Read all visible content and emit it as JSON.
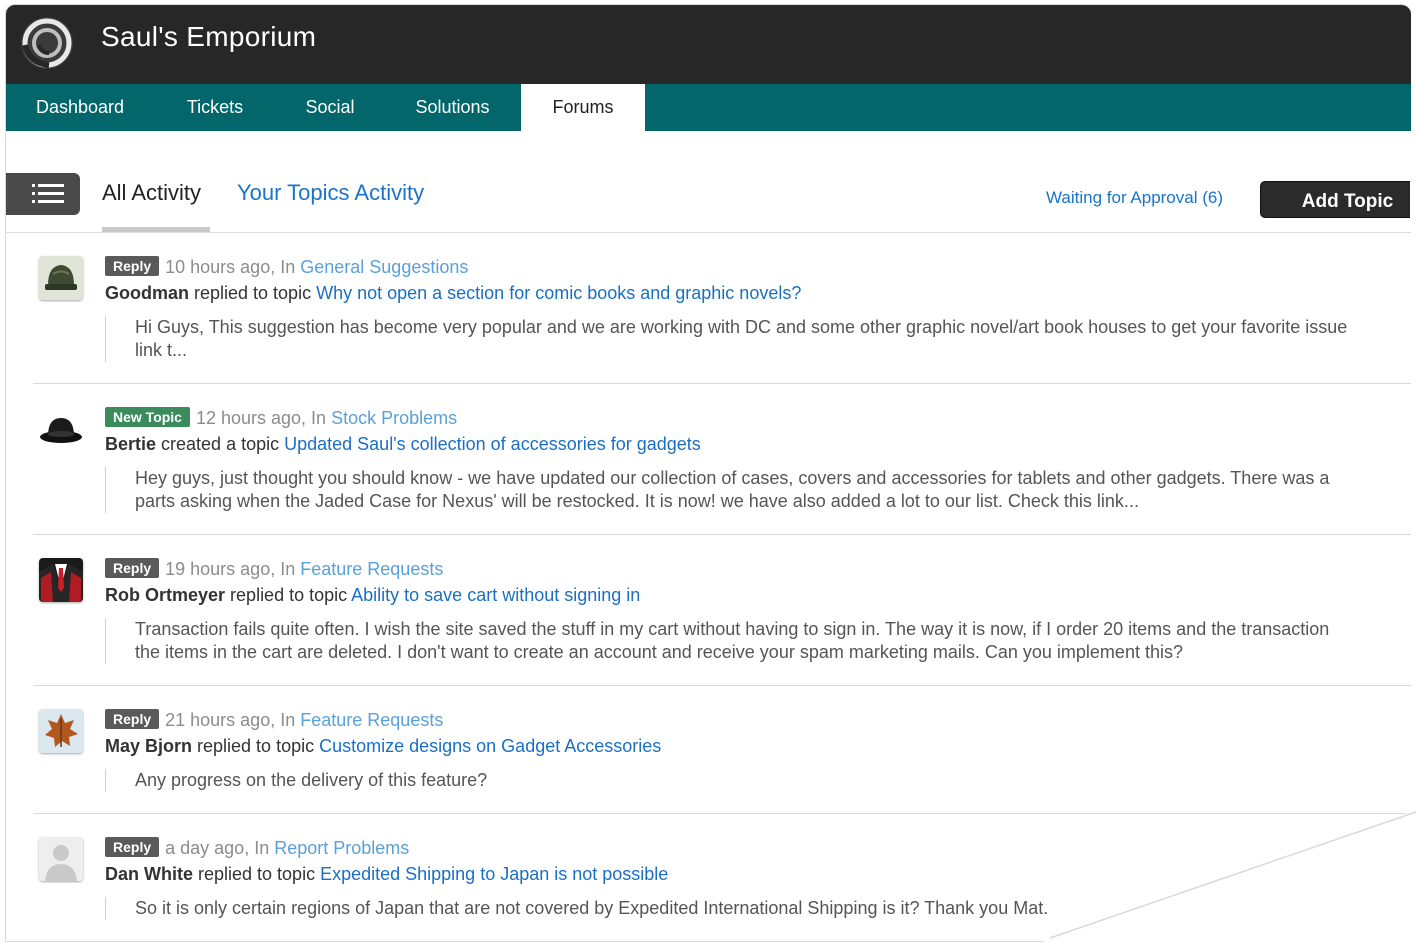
{
  "app": {
    "title": "Saul's Emporium",
    "logo_icon": "swirl-logo-icon"
  },
  "nav": {
    "items": [
      {
        "label": "Dashboard",
        "active": false
      },
      {
        "label": "Tickets",
        "active": false
      },
      {
        "label": "Social",
        "active": false
      },
      {
        "label": "Solutions",
        "active": false
      },
      {
        "label": "Forums",
        "active": true
      }
    ]
  },
  "tabs": {
    "all": "All Activity",
    "yours": "Your Topics Activity"
  },
  "actions": {
    "waiting": "Waiting for Approval (6)",
    "add_topic": "Add Topic"
  },
  "colors": {
    "topbar": "#272727",
    "nav": "#03666b",
    "link": "#1a6fc4",
    "reply_badge": "#5a5a5a",
    "new_topic_badge": "#3a8c5c"
  },
  "activities": [
    {
      "avatar": "helmet-avatar",
      "badge": "Reply",
      "time": "10 hours ago, In",
      "forum": "General Suggestions",
      "author": "Goodman",
      "action": " replied to topic ",
      "topic": "Why not open a section for comic books and graphic novels?",
      "excerpt1": "Hi Guys, This suggestion has become very popular and we are working with DC and some other graphic novel/art book houses to get your favorite issue",
      "excerpt2": "link t..."
    },
    {
      "avatar": "bowler-hat-avatar",
      "badge": "New Topic",
      "time": "12 hours ago, In",
      "forum": "Stock Problems",
      "author": "Bertie",
      "action": " created a topic ",
      "topic": "Updated Saul's collection of accessories for gadgets",
      "excerpt1": "Hey guys, just thought you should know - we have updated our collection of cases, covers and accessories for tablets and other gadgets. There was a",
      "excerpt2": "parts asking when the Jaded Case for Nexus' will be restocked. It is now! we have also added a lot to our list. Check this link..."
    },
    {
      "avatar": "suit-avatar",
      "badge": "Reply",
      "time": "19 hours ago, In",
      "forum": "Feature Requests",
      "author": "Rob Ortmeyer",
      "action": " replied to topic ",
      "topic": "Ability to save cart without signing in",
      "excerpt1": "Transaction fails quite often. I wish the site saved the stuff in my cart without having to sign in. The way it is now, if I order 20 items and the transaction",
      "excerpt2": "the items in the cart are deleted. I don't want to create an account and receive your spam marketing mails. Can you implement this?"
    },
    {
      "avatar": "leaf-avatar",
      "badge": "Reply",
      "time": "21 hours ago, In",
      "forum": "Feature Requests",
      "author": "May Bjorn",
      "action": " replied to topic ",
      "topic": "Customize designs on Gadget Accessories",
      "excerpt1": "Any progress on the delivery of this feature?",
      "excerpt2": ""
    },
    {
      "avatar": "default-user-avatar",
      "badge": "Reply",
      "time": "a day ago, In",
      "forum": "Report Problems",
      "author": "Dan White",
      "action": " replied to topic ",
      "topic": "Expedited Shipping to Japan is not possible",
      "excerpt1": "So it is only certain regions of Japan that are not covered by Expedited International Shipping is it? Thank you Mat.",
      "excerpt2": ""
    }
  ]
}
